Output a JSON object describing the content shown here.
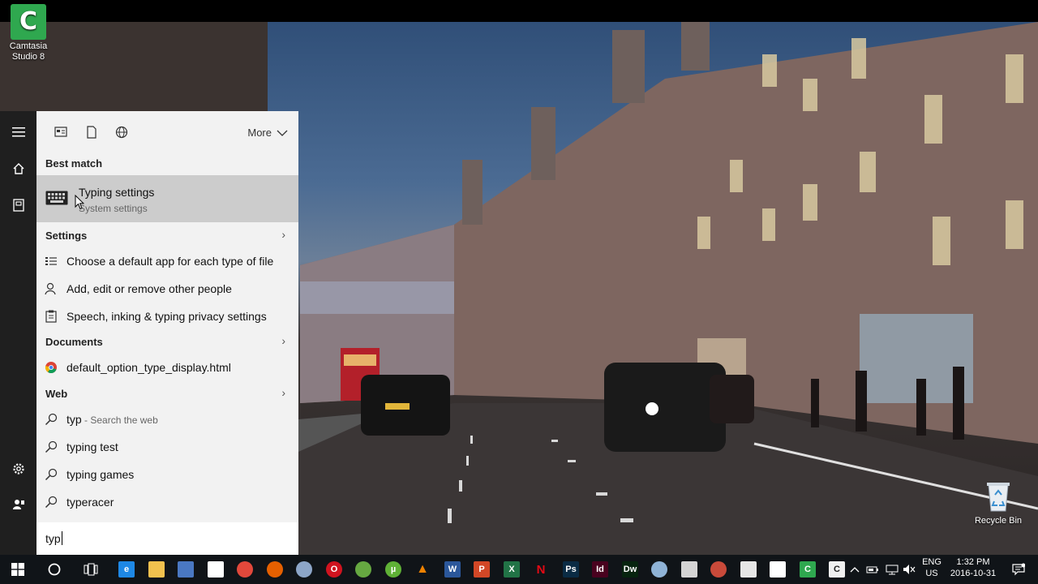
{
  "desktop": {
    "icons": [
      {
        "label_line1": "Camtasia",
        "label_line2": "Studio 8"
      },
      {
        "label": "Recycle Bin"
      }
    ]
  },
  "search_panel": {
    "filter_icons": [
      "apps-filter-icon",
      "documents-filter-icon",
      "web-filter-icon"
    ],
    "more_label": "More",
    "best_match": {
      "header": "Best match",
      "title": "Typing settings",
      "subtitle": "System settings",
      "icon": "keyboard-icon"
    },
    "settings": {
      "header": "Settings",
      "items": [
        {
          "label": "Choose a default app for each type of file",
          "icon": "default-apps-icon"
        },
        {
          "label": "Add, edit or remove other people",
          "icon": "person-icon"
        },
        {
          "label": "Speech, inking & typing privacy settings",
          "icon": "privacy-icon"
        }
      ]
    },
    "documents": {
      "header": "Documents",
      "items": [
        {
          "label": "default_option_type_display.html",
          "icon": "chrome-document-icon"
        }
      ]
    },
    "web": {
      "header": "Web",
      "items": [
        {
          "label": "typ",
          "hint": " - Search the web",
          "icon": "search-icon"
        },
        {
          "label": "typing test",
          "icon": "search-icon"
        },
        {
          "label": "typing games",
          "icon": "search-icon"
        },
        {
          "label": "typeracer",
          "icon": "search-icon"
        }
      ]
    },
    "query": "typ"
  },
  "taskbar": {
    "language_line1": "ENG",
    "language_line2": "US",
    "time": "1:32 PM",
    "date": "2016-10-31",
    "apps": [
      {
        "name": "edge",
        "color": "#1e88e5",
        "glyph": "e"
      },
      {
        "name": "file-explorer",
        "color": "#f2c14e",
        "glyph": ""
      },
      {
        "name": "network",
        "color": "#4a78c2",
        "glyph": ""
      },
      {
        "name": "store",
        "color": "#ffffff",
        "glyph": ""
      },
      {
        "name": "chrome",
        "color": "#e2483b",
        "glyph": ""
      },
      {
        "name": "firefox",
        "color": "#e66000",
        "glyph": ""
      },
      {
        "name": "disk-tool",
        "color": "#8da6c8",
        "glyph": ""
      },
      {
        "name": "opera",
        "color": "#d0131f",
        "glyph": "O"
      },
      {
        "name": "xbox",
        "color": "#66a841",
        "glyph": ""
      },
      {
        "name": "utorrent",
        "color": "#5fb136",
        "glyph": "µ"
      },
      {
        "name": "vlc",
        "color": "#f08200",
        "glyph": "▲"
      },
      {
        "name": "word",
        "color": "#2b579a",
        "glyph": "W"
      },
      {
        "name": "powerpoint",
        "color": "#d24726",
        "glyph": "P"
      },
      {
        "name": "excel",
        "color": "#217346",
        "glyph": "X"
      },
      {
        "name": "netflix",
        "color": "#101418",
        "glyph": "N"
      },
      {
        "name": "photoshop",
        "color": "#0a2b44",
        "glyph": "Ps"
      },
      {
        "name": "indesign",
        "color": "#49021f",
        "glyph": "Id"
      },
      {
        "name": "dreamweaver",
        "color": "#07240f",
        "glyph": "Dw"
      },
      {
        "name": "globe-app",
        "color": "#8fb3d6",
        "glyph": ""
      },
      {
        "name": "popcorn",
        "color": "#d4d4d4",
        "glyph": ""
      },
      {
        "name": "media-app",
        "color": "#c94a3a",
        "glyph": ""
      },
      {
        "name": "calculator",
        "color": "#e6e6e6",
        "glyph": ""
      },
      {
        "name": "inkscape",
        "color": "#ffffff",
        "glyph": ""
      },
      {
        "name": "camtasia",
        "color": "#2fa84f",
        "glyph": "C"
      },
      {
        "name": "camtasia-recorder",
        "color": "#f0f0f0",
        "glyph": "C"
      }
    ]
  }
}
